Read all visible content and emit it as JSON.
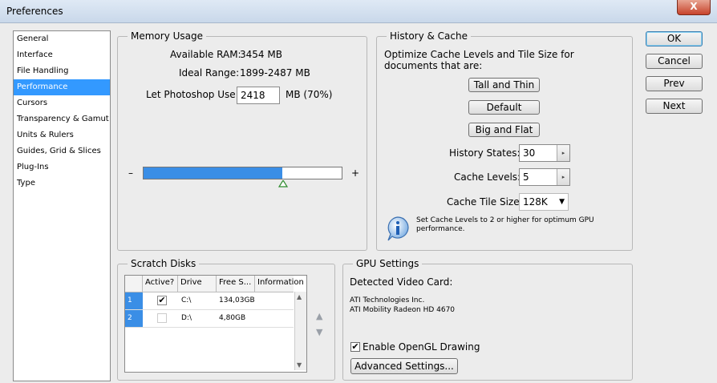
{
  "window": {
    "title": "Preferences",
    "close_label": "X"
  },
  "nav": {
    "items": [
      "General",
      "Interface",
      "File Handling",
      "Performance",
      "Cursors",
      "Transparency & Gamut",
      "Units & Rulers",
      "Guides, Grid & Slices",
      "Plug-Ins",
      "Type"
    ],
    "selected_index": 3
  },
  "memory": {
    "legend": "Memory Usage",
    "available_label": "Available RAM:",
    "available_value": "3454 MB",
    "ideal_label": "Ideal Range:",
    "ideal_value": "1899-2487 MB",
    "use_label": "Let Photoshop Use:",
    "use_value": "2418",
    "use_unit": "MB (70%)",
    "minus": "–",
    "plus": "+",
    "slider_fraction": 0.7
  },
  "history": {
    "legend": "History & Cache",
    "intro": "Optimize Cache Levels and Tile Size for documents that are:",
    "btn_tall": "Tall and Thin",
    "btn_default": "Default",
    "btn_big": "Big and Flat",
    "states_label": "History States:",
    "states_value": "30",
    "levels_label": "Cache Levels:",
    "levels_value": "5",
    "tile_label": "Cache Tile Size:",
    "tile_value": "128K",
    "note": "Set Cache Levels to 2 or higher for optimum GPU performance."
  },
  "scratch": {
    "legend": "Scratch Disks",
    "headers": [
      "Active?",
      "Drive",
      "Free S...",
      "Information"
    ],
    "rows": [
      {
        "num": "1",
        "active": true,
        "drive": "C:\\",
        "free": "134,03GB"
      },
      {
        "num": "2",
        "active": false,
        "drive": "D:\\",
        "free": "4,80GB"
      }
    ]
  },
  "gpu": {
    "legend": "GPU Settings",
    "detected_label": "Detected Video Card:",
    "vendor": "ATI Technologies Inc.",
    "card": "ATI Mobility Radeon HD 4670",
    "opengl_label": "Enable OpenGL Drawing",
    "opengl_checked": true,
    "advanced": "Advanced Settings..."
  },
  "actions": {
    "ok": "OK",
    "cancel": "Cancel",
    "prev": "Prev",
    "next": "Next"
  }
}
